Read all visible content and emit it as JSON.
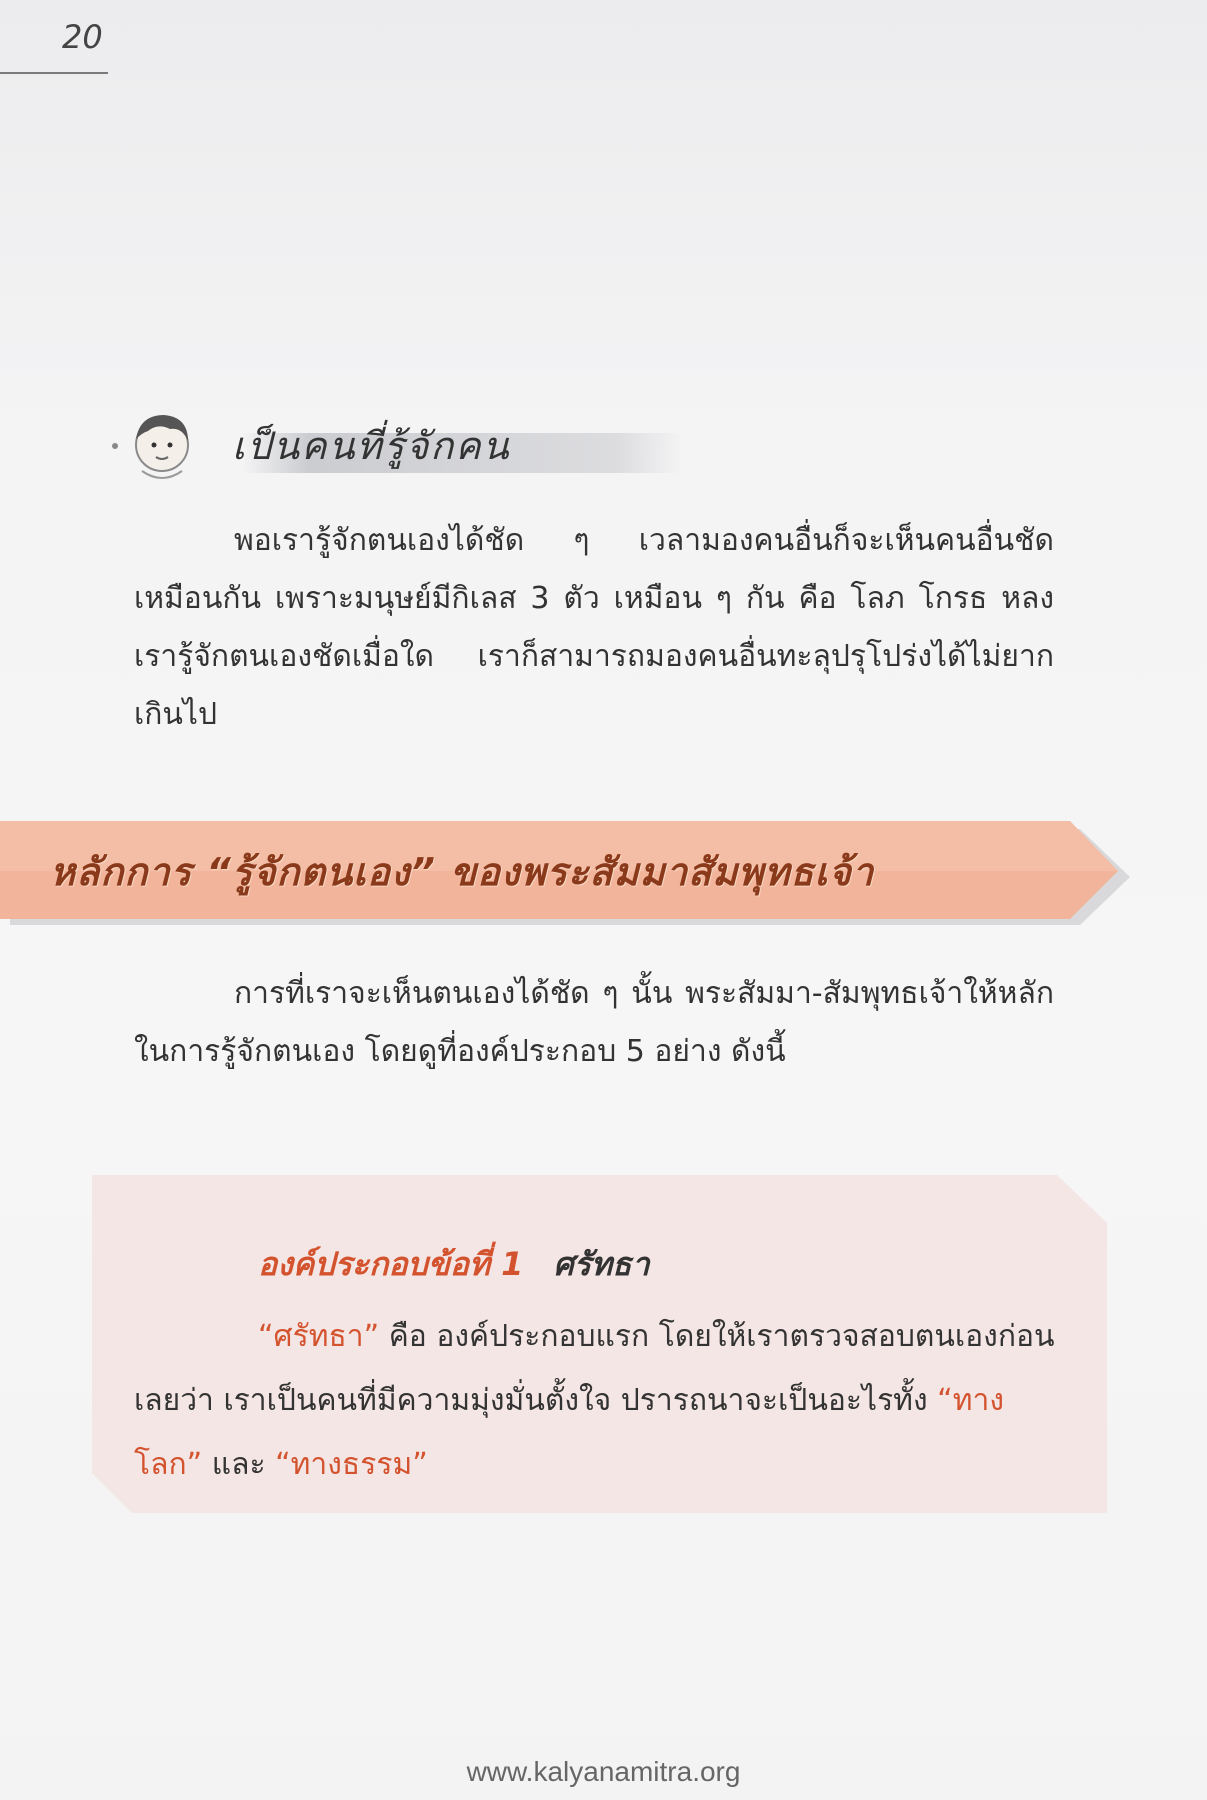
{
  "page": {
    "number": "20",
    "footer_url": "www.kalyanamitra.org"
  },
  "section1": {
    "heading": "เป็นคนที่รู้จักคน",
    "icon": "cartoon-boy-icon",
    "paragraph": "พอเรารู้จักตนเองได้ชัด ๆ เวลามองคนอื่นก็จะเห็นคนอื่นชัดเหมือนกัน เพราะมนุษย์มีกิเลส 3 ตัว เหมือน ๆ กัน คือ โลภ โกรธ หลง เรารู้จักตนเองชัดเมื่อใด เราก็สามารถมองคนอื่นทะลุปรุโปร่งได้ไม่ยากเกินไป"
  },
  "banner": {
    "title": "หลักการ “รู้จักตนเอง” ของพระสัมมาสัมพุทธเจ้า",
    "color": "#f2b49a"
  },
  "section2": {
    "paragraph": "การที่เราจะเห็นตนเองได้ชัด ๆ นั้น พระสัมมา-สัมพุทธเจ้าให้หลักในการรู้จักตนเอง โดยดูที่องค์ประกอบ 5 อย่าง ดังนี้"
  },
  "callout": {
    "label": "องค์ประกอบข้อที่ 1",
    "title": "ศรัทธา",
    "term": "“ศรัทธา”",
    "text_a": " คือ องค์ประกอบแรก โดยให้เราตรวจสอบตนเองก่อนเลยว่า เราเป็นคนที่มีความมุ่งมั่นตั้งใจ ปรารถนาจะเป็นอะไรทั้ง ",
    "term_world": "“ทางโลก”",
    "text_b": " และ ",
    "term_dhamma": "“ทางธรรม”",
    "background_color": "#f4e6e4",
    "accent_color": "#d4532f"
  }
}
